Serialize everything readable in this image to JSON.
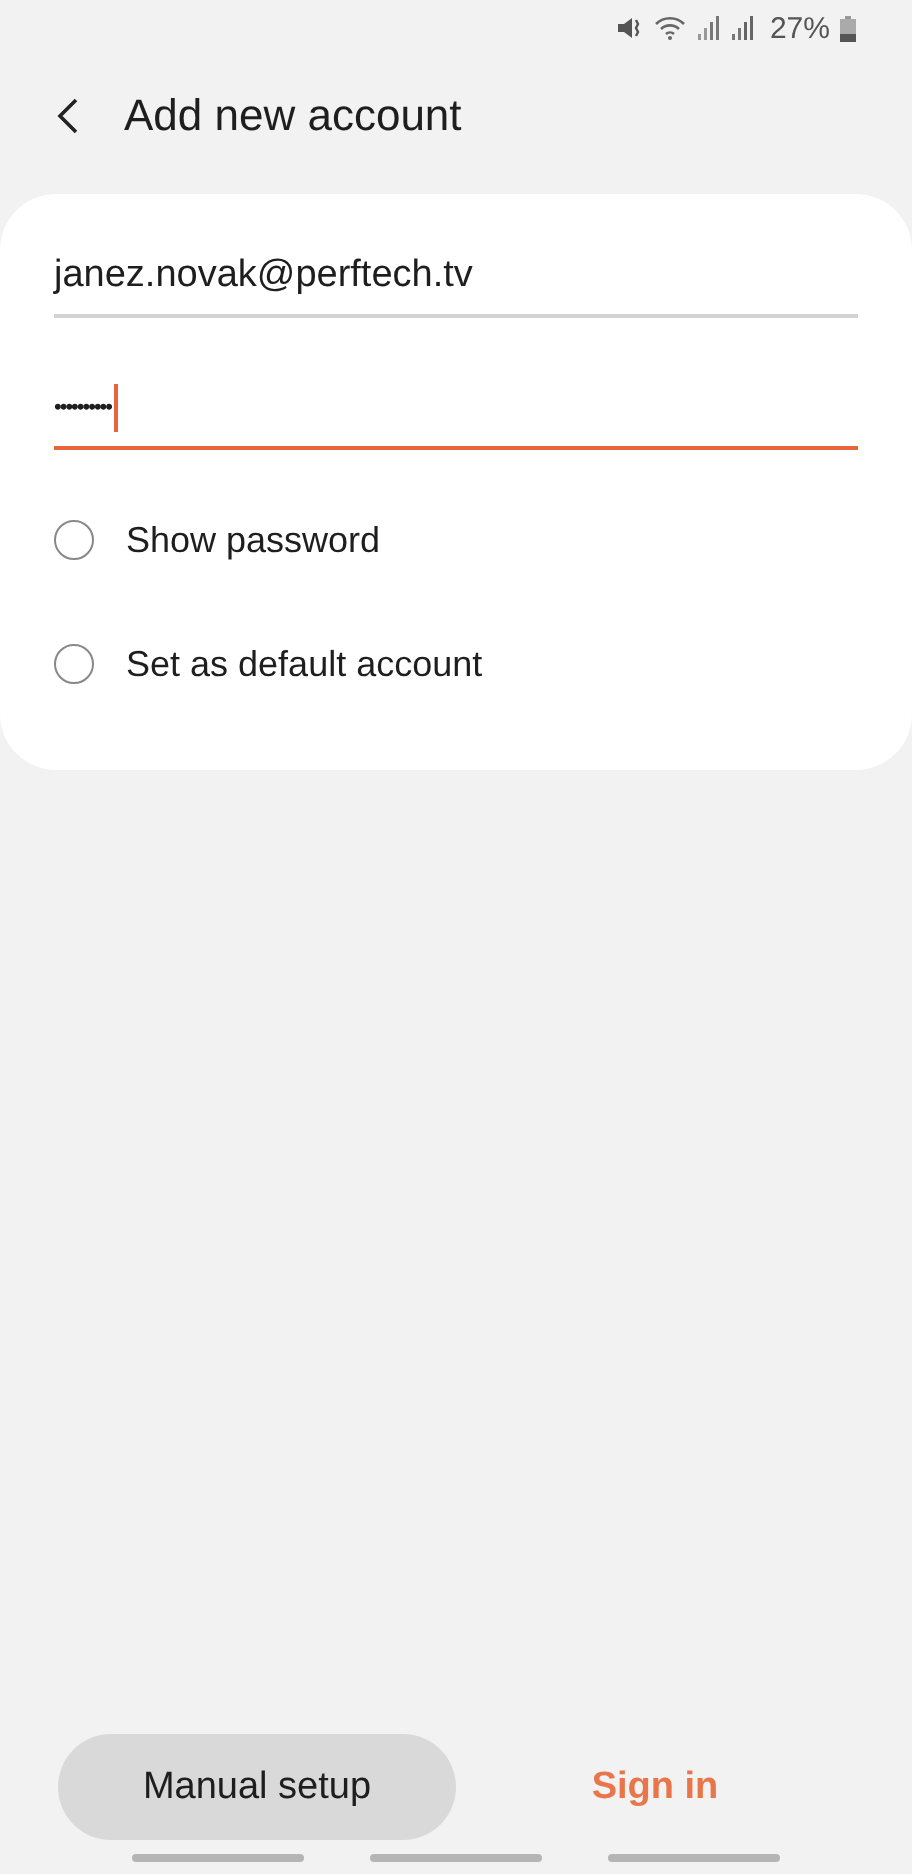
{
  "status_bar": {
    "battery": "27%"
  },
  "header": {
    "title": "Add new account"
  },
  "fields": [
    {
      "kind": "email",
      "value": "janez.novak@perftech.tv",
      "focused": false
    },
    {
      "kind": "password",
      "value": "••••••••••",
      "focused": true
    }
  ],
  "options": [
    {
      "label": "Show password",
      "checked": false
    },
    {
      "label": "Set as default account",
      "checked": false
    }
  ],
  "buttons": [
    {
      "kind": "secondary",
      "label": "Manual setup"
    },
    {
      "kind": "primary",
      "label": "Sign in"
    }
  ]
}
